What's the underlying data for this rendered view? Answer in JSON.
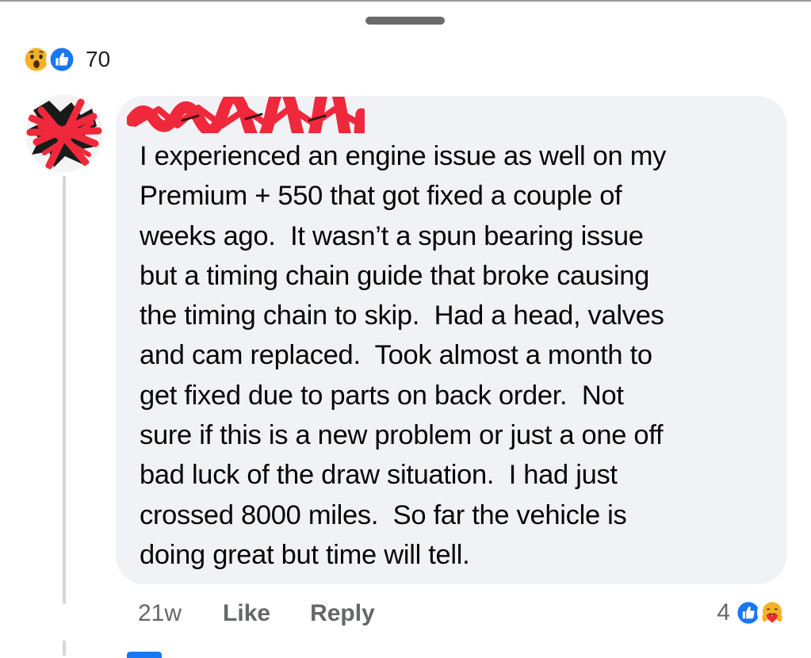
{
  "sheet": {
    "handle_icon": "drag-handle"
  },
  "post_reactions": {
    "icons": [
      "wow-icon",
      "like-icon"
    ],
    "count": "70"
  },
  "comment": {
    "author_redacted": true,
    "text_lines": [
      "I experienced an engine issue as well on my",
      "Premium + 550 that got fixed a couple of",
      "weeks ago.  It wasn’t a spun bearing issue",
      "but a timing chain guide that broke causing",
      "the timing chain to skip.  Had a head, valves",
      "and cam replaced.  Took almost a month to",
      "get fixed due to parts on back order.  Not",
      "sure if this is a new problem or just a one off",
      "bad luck of the draw situation.  I had just",
      "crossed 8000 miles.  So far the vehicle is",
      "doing great but time will tell."
    ],
    "timestamp": "21w",
    "like_label": "Like",
    "reply_label": "Reply",
    "reaction_count": "4",
    "reaction_icons": [
      "like-icon",
      "care-icon"
    ]
  },
  "colors": {
    "bubble_bg": "#f0f2f5",
    "like_blue": "#1877f2",
    "wow_yellow": "#f7b125",
    "redaction_red": "#f0283c",
    "meta_gray": "#65676b"
  }
}
